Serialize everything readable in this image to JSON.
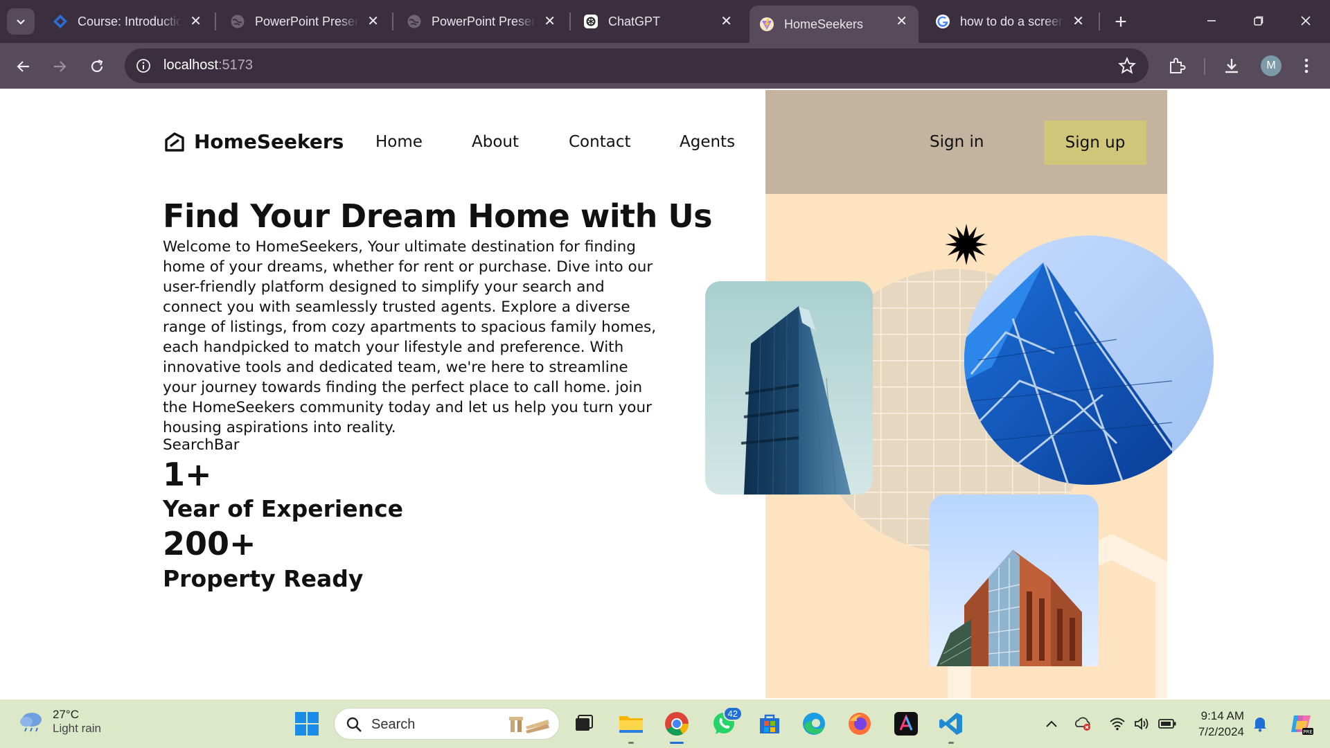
{
  "browser": {
    "tabs": [
      {
        "title": "Course: Introductio",
        "icon": "course-site-icon"
      },
      {
        "title": "PowerPoint Presen",
        "icon": "globe-icon"
      },
      {
        "title": "PowerPoint Presen",
        "icon": "globe-icon"
      },
      {
        "title": "ChatGPT",
        "icon": "chatgpt-icon"
      },
      {
        "title": "HomeSeekers",
        "icon": "vite-icon"
      },
      {
        "title": "how to do a screen",
        "icon": "google-icon"
      }
    ],
    "active_tab": 4,
    "url_host": "localhost",
    "url_port": ":5173",
    "profile_initial": "M"
  },
  "page": {
    "logo_text": "HomeSeekers",
    "nav": [
      "Home",
      "About",
      "Contact",
      "Agents"
    ],
    "sign_in": "Sign in",
    "sign_up": "Sign up",
    "hero_title": "Find Your Dream Home with Us",
    "hero_text": "Welcome to HomeSeekers, Your ultimate destination for finding home of your dreams, whether for rent or purchase. Dive into our user-friendly platform designed to simplify your search and connect you with seamlessly trusted agents. Explore a diverse range of listings, from cozy apartments to spacious family homes, each handpicked to match your lifestyle and preference. With innovative tools and dedicated team, we're here to streamline your journey towards finding the perfect place to call home. join the HomeSeekers community today and let us help you turn your housing aspirations into reality.",
    "search_placeholder": "SearchBar",
    "stats": [
      {
        "value": "1+",
        "label": "Year of Experience"
      },
      {
        "value": "200+",
        "label": "Property Ready"
      }
    ],
    "colors": {
      "hero_panel": "#fde3c0",
      "header_strip": "#c4b49f",
      "signup_button": "#cfc67a"
    }
  },
  "taskbar": {
    "weather_temp": "27°C",
    "weather_condition": "Light rain",
    "search_label": "Search",
    "whatsapp_badge": "42",
    "time": "9:14 AM",
    "date": "7/2/2024"
  }
}
